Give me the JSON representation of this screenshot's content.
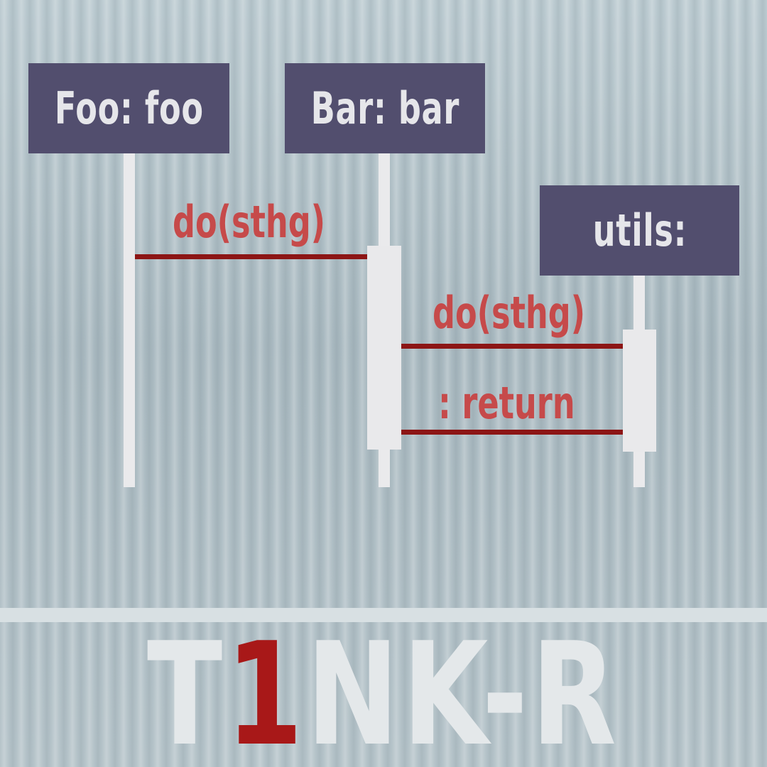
{
  "diagram": {
    "participants": [
      {
        "id": "foo",
        "label": "Foo: foo"
      },
      {
        "id": "bar",
        "label": "Bar: bar"
      },
      {
        "id": "utils",
        "label": "utils:"
      }
    ],
    "messages": [
      {
        "from": "foo",
        "to": "bar",
        "label": "do(sthg)"
      },
      {
        "from": "bar",
        "to": "utils",
        "label": "do(sthg)"
      },
      {
        "from": "utils",
        "to": "bar",
        "label": ": return"
      }
    ]
  },
  "brand": {
    "prefix": "T",
    "accent": "1",
    "suffix": "NK-R",
    "accent_color": "#a81818"
  },
  "colors": {
    "participant_box": "#524e6e",
    "message_line": "#8c1515",
    "message_text": "#c64a4a"
  }
}
